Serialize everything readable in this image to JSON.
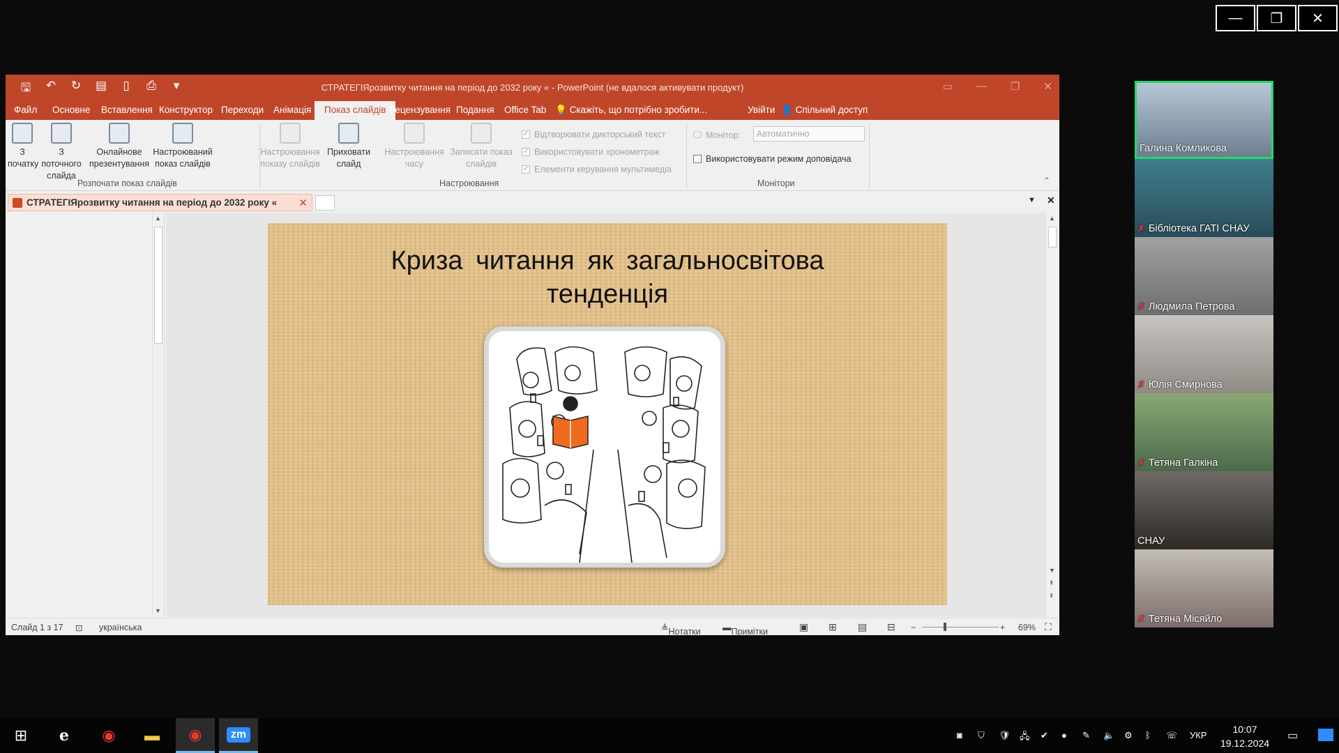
{
  "zoom": {
    "minimize": "—",
    "restore": "❐",
    "close": "✕"
  },
  "ppt": {
    "window_title": "СТРАТЕГІЯрозвитку читання на період до 2032 року « - PowerPoint (не вдалося активувати продукт)",
    "tabs": [
      "Файл",
      "Основне",
      "Вставлення",
      "Конструктор",
      "Переходи",
      "Анімація",
      "Показ слайдів",
      "Рецензування",
      "Подання",
      "Office Tab"
    ],
    "active_tab": "Показ слайдів",
    "tell_me": "Скажіть, що потрібно зробити...",
    "sign_in": "Увійти",
    "share": "Спільний доступ",
    "ribbon": {
      "from_start_1": "З",
      "from_start_2": "початку",
      "from_current_1": "З поточного",
      "from_current_2": "слайда",
      "online_1": "Онлайнове",
      "online_2": "презентування",
      "custom_1": "Настроюваний",
      "custom_2": "показ слайдів",
      "group_start": "Розпочати показ слайдів",
      "setup_1": "Настроювання",
      "setup_2": "показу слайдів",
      "hide_1": "Приховати",
      "hide_2": "слайд",
      "rehearse_1": "Настроювання",
      "rehearse_2": "часу",
      "record_1": "Записати показ",
      "record_2": "слайдів",
      "chk_narration": "Відтворювати дикторський текст",
      "chk_timings": "Використовувати хронометраж",
      "chk_media": "Елементи керування мультимедіа",
      "group_setup": "Настроювання",
      "monitor_label": "Монітор:",
      "monitor_value": "Автоматично",
      "presenter_view": "Використовувати режим доповідача",
      "group_monitors": "Монітори"
    },
    "doc_tab": "СТРАТЕГІЯрозвитку читання на період до 2032 року «",
    "slide_title_1": "Криза читання як загальносвітова",
    "slide_title_2": "тенденція",
    "status": {
      "slide": "Слайд 1 з 17",
      "language": "українська",
      "notes": "Нотатки",
      "comments": "Примітки",
      "zoom": "69%"
    }
  },
  "participants": [
    {
      "name": "Галина Комликова",
      "muted": false,
      "speaking": true
    },
    {
      "name": "Бібліотека ГАТІ СНАУ",
      "muted": true,
      "speaking": false
    },
    {
      "name": "Людмила Петрова",
      "muted": true,
      "speaking": false
    },
    {
      "name": "Юлія Смирнова",
      "muted": true,
      "speaking": false
    },
    {
      "name": "Тетяна Галкіна",
      "muted": true,
      "speaking": false
    },
    {
      "name": "СНАУ",
      "muted": false,
      "speaking": false
    },
    {
      "name": "Тетяна Місяйло",
      "muted": true,
      "speaking": false
    }
  ],
  "taskbar": {
    "language": "УКР",
    "time": "10:07",
    "date": "19.12.2024",
    "zoom_app_label": "zm"
  }
}
